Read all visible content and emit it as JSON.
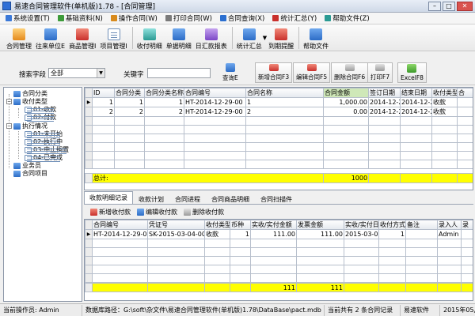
{
  "window": {
    "title": "易速合同管理软件(单机版)1.78 - [合同管理]",
    "min": "–",
    "max": "□",
    "close": "✕"
  },
  "menu": [
    {
      "label": "系统设置(T)",
      "color": "#3b79d8"
    },
    {
      "label": "基础资料(N)",
      "color": "#3d9b3a"
    },
    {
      "label": "操作合同(W)",
      "color": "#d88a1c"
    },
    {
      "label": "打印合同(W)",
      "color": "#7a7a7a"
    },
    {
      "label": "合同查询(X)",
      "color": "#2b6fd0"
    },
    {
      "label": "统计汇总(Y)",
      "color": "#c9302c"
    },
    {
      "label": "帮助文件(Z)",
      "color": "#2a9a93"
    }
  ],
  "toolbar": [
    {
      "label": "合同管理",
      "icon": "clipboard-icon",
      "color": "ic-orange"
    },
    {
      "label": "往来单位E",
      "icon": "people-icon",
      "color": "ic-blue"
    },
    {
      "label": "商品管理I",
      "icon": "goods-icon",
      "color": "ic-red"
    },
    {
      "label": "项目管理I",
      "icon": "project-icon",
      "color": "ic-doc"
    },
    {
      "label": "收付明细",
      "icon": "receipt-icon",
      "color": "ic-teal"
    },
    {
      "label": "单据明细",
      "icon": "document-icon",
      "color": "ic-blue"
    },
    {
      "label": "日汇款报表",
      "icon": "report-icon",
      "color": "ic-purple"
    },
    {
      "label": "统计汇总",
      "icon": "stats-icon",
      "color": "ic-blue"
    },
    {
      "label": "到期提醒",
      "icon": "alarm-icon",
      "color": "ic-red"
    },
    {
      "label": "帮助文件",
      "icon": "help-icon",
      "color": "ic-blue"
    }
  ],
  "search": {
    "field_label": "搜索字段",
    "field_value": "全部",
    "keyword_label": "关键字",
    "keyword_value": "",
    "query": "查询E",
    "add": "新增合同F3",
    "edit": "编辑合同F5",
    "delete": "删除合同F6",
    "print": "打印F7",
    "excel": "ExcelF8"
  },
  "tree": {
    "root1": "合同分类",
    "root2": "收付类型",
    "n21": "01-收款",
    "n22": "02-付款",
    "root3": "执行情况",
    "n31": "01-未开始",
    "n32": "02-执行中",
    "n33": "03-中止搁置",
    "n34": "04-已完成",
    "root4": "业务员",
    "root5": "合同项目"
  },
  "contracts": {
    "columns": [
      "ID",
      "合同分类",
      "合同分类名称",
      "合同编号",
      "合同名称",
      "合同金额",
      "签订日期",
      "结束日期",
      "收付类型",
      "合"
    ],
    "rows": [
      [
        "1",
        "1",
        "1",
        "HT-2014-12-29-00",
        "1",
        "1,000.00",
        "2014-12-2",
        "2014-12-2",
        "收款",
        ""
      ],
      [
        "2",
        "2",
        "2",
        "HT-2014-12-29-00",
        "2",
        "0.00",
        "2014-12-2",
        "2014-12-2",
        "收款",
        ""
      ]
    ],
    "total_label": "总计:",
    "total_amount": "1000"
  },
  "tabs": [
    "收款明细记录",
    "收款计划",
    "合同进程",
    "合同商品明细",
    "合同扫描件"
  ],
  "sub_actions": {
    "add": "新增收付款",
    "edit": "编辑收付款",
    "delete": "删除收付款"
  },
  "payments": {
    "columns": [
      "合同编号",
      "凭证号",
      "收付类型",
      "币种",
      "实收/实付金额",
      "发票金额",
      "实收/实付日期",
      "收付方式",
      "备注",
      "录入人",
      "录"
    ],
    "rows": [
      [
        "HT-2014-12-29-00",
        "SK-2015-03-04-00",
        "收款",
        "1",
        "111.00",
        "111.00",
        "2015-03-0",
        "1",
        "",
        "Admin",
        ""
      ]
    ],
    "total_paid": "111",
    "total_invoice": "111"
  },
  "status": {
    "operator": "当前操作员: Admin",
    "db_path": "数据库路径：G:\\soft\\杂文件\\易速合同管理软件(单机版)1.78\\DataBase\\pact.mdb",
    "count": "当前共有 2 条合同记录",
    "company": "易速软件",
    "date": "2015年05月"
  }
}
